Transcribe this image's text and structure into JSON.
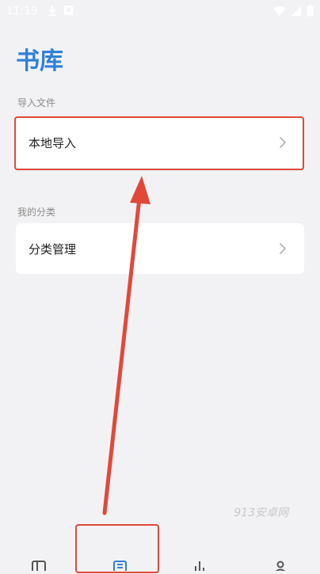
{
  "status_bar": {
    "time": "11:19",
    "left_icons": [
      "download-icon",
      "notification-icon"
    ],
    "right_icons": [
      "wifi-icon",
      "signal-icon",
      "battery-icon"
    ]
  },
  "page": {
    "title": "书库"
  },
  "import_section": {
    "label": "导入文件",
    "items": [
      {
        "label": "本地导入",
        "icon": "chevron-right-icon"
      }
    ]
  },
  "category_section": {
    "label": "我的分类",
    "items": [
      {
        "label": "分类管理",
        "icon": "chevron-right-icon"
      }
    ]
  },
  "watermark": "913安卓网",
  "bottom_nav": {
    "items": [
      {
        "icon": "bookshelf-icon"
      },
      {
        "icon": "library-icon",
        "selected": true
      },
      {
        "icon": "stats-icon"
      },
      {
        "icon": "profile-icon"
      }
    ]
  },
  "colors": {
    "accent": "#2f7fd8",
    "annotation": "#e0493a",
    "background": "#f2f2f4"
  }
}
